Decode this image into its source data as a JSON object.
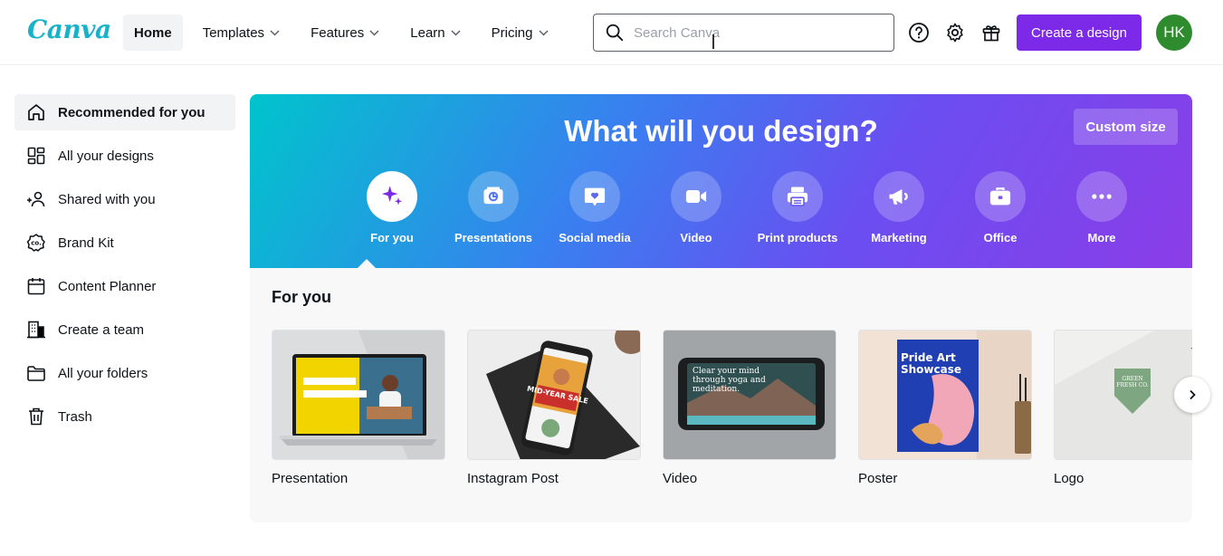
{
  "header": {
    "logo": "Canva",
    "nav": [
      {
        "label": "Home",
        "has_dropdown": false,
        "active": true
      },
      {
        "label": "Templates",
        "has_dropdown": true
      },
      {
        "label": "Features",
        "has_dropdown": true
      },
      {
        "label": "Learn",
        "has_dropdown": true
      },
      {
        "label": "Pricing",
        "has_dropdown": true
      }
    ],
    "search_placeholder": "Search Canva",
    "create_button": "Create a design",
    "avatar_initials": "HK",
    "icons": [
      "help-icon",
      "settings-icon",
      "gift-icon"
    ]
  },
  "sidebar": {
    "items": [
      {
        "label": "Recommended for you",
        "icon": "home-icon",
        "active": true
      },
      {
        "label": "All your designs",
        "icon": "grid-icon"
      },
      {
        "label": "Shared with you",
        "icon": "people-icon"
      },
      {
        "label": "Brand Kit",
        "icon": "brand-kit-icon"
      },
      {
        "label": "Content Planner",
        "icon": "calendar-icon"
      },
      {
        "label": "Create a team",
        "icon": "building-icon"
      },
      {
        "label": "All your folders",
        "icon": "folder-icon"
      },
      {
        "label": "Trash",
        "icon": "trash-icon"
      }
    ]
  },
  "hero": {
    "title": "What will you design?",
    "custom_size": "Custom size",
    "categories": [
      {
        "label": "For you",
        "icon": "sparkle-icon",
        "active": true
      },
      {
        "label": "Presentations",
        "icon": "presentation-icon"
      },
      {
        "label": "Social media",
        "icon": "heart-icon"
      },
      {
        "label": "Video",
        "icon": "video-icon"
      },
      {
        "label": "Print products",
        "icon": "printer-icon"
      },
      {
        "label": "Marketing",
        "icon": "megaphone-icon"
      },
      {
        "label": "Office",
        "icon": "briefcase-icon"
      },
      {
        "label": "More",
        "icon": "more-icon"
      }
    ]
  },
  "for_you": {
    "title": "For you",
    "cards": [
      {
        "label": "Presentation"
      },
      {
        "label": "Instagram Post",
        "thumb_text": "MID-YEAR SALE"
      },
      {
        "label": "Video",
        "thumb_text": "Clear your mind through yoga and meditation."
      },
      {
        "label": "Poster",
        "thumb_text": "Pride Art Showcase"
      },
      {
        "label": "Logo",
        "thumb_text": "GREEN FRESH CO."
      }
    ]
  },
  "colors": {
    "brand_purple": "#7d2ae8",
    "brand_teal": "#00c4cc",
    "avatar_green": "#2e8b2e"
  }
}
